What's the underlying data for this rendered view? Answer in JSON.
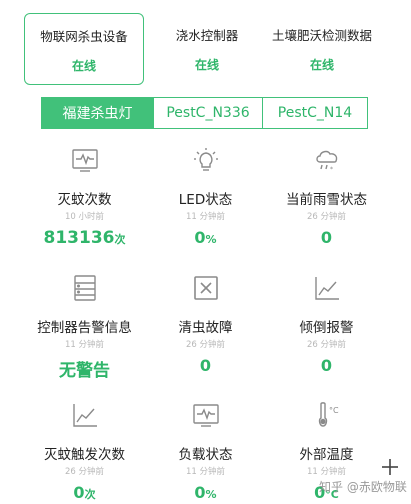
{
  "devices": [
    {
      "name": "物联网杀虫设备",
      "status": "在线",
      "active": true
    },
    {
      "name": "浇水控制器",
      "status": "在线",
      "active": false
    },
    {
      "name": "土壤肥沃检测数据",
      "status": "在线",
      "active": false
    }
  ],
  "tabs": [
    {
      "label": "福建杀虫灯",
      "active": true
    },
    {
      "label": "PestC_N336",
      "active": false
    },
    {
      "label": "PestC_N14",
      "active": false
    }
  ],
  "sensors": [
    {
      "label": "灭蚊次数",
      "time": "10 小时前",
      "value": "813136",
      "unit": "次",
      "icon": "pulse-monitor-icon"
    },
    {
      "label": "LED状态",
      "time": "11 分钟前",
      "value": "0",
      "unit": "%",
      "icon": "light-bulb-icon"
    },
    {
      "label": "当前雨雪状态",
      "time": "26 分钟前",
      "value": "0",
      "unit": "",
      "icon": "rain-snow-cloud-icon"
    },
    {
      "label": "控制器告警信息",
      "time": "11 分钟前",
      "value": "无警告",
      "unit": "",
      "icon": "document-list-icon"
    },
    {
      "label": "清虫故障",
      "time": "26 分钟前",
      "value": "0",
      "unit": "",
      "icon": "x-box-icon"
    },
    {
      "label": "倾倒报警",
      "time": "26 分钟前",
      "value": "0",
      "unit": "",
      "icon": "line-chart-icon"
    },
    {
      "label": "灭蚊触发次数",
      "time": "26 分钟前",
      "value": "0",
      "unit": "次",
      "icon": "line-chart-icon"
    },
    {
      "label": "负载状态",
      "time": "11 分钟前",
      "value": "0",
      "unit": "%",
      "icon": "pulse-monitor-icon"
    },
    {
      "label": "外部温度",
      "time": "11 分钟前",
      "value": "0",
      "unit": "°C",
      "icon": "thermometer-celsius-icon"
    }
  ],
  "watermark": "知乎 @赤欧物联",
  "colors": {
    "accent": "#41c17a",
    "value_green": "#2fb56a",
    "icon_gray": "#8a8a8a"
  }
}
